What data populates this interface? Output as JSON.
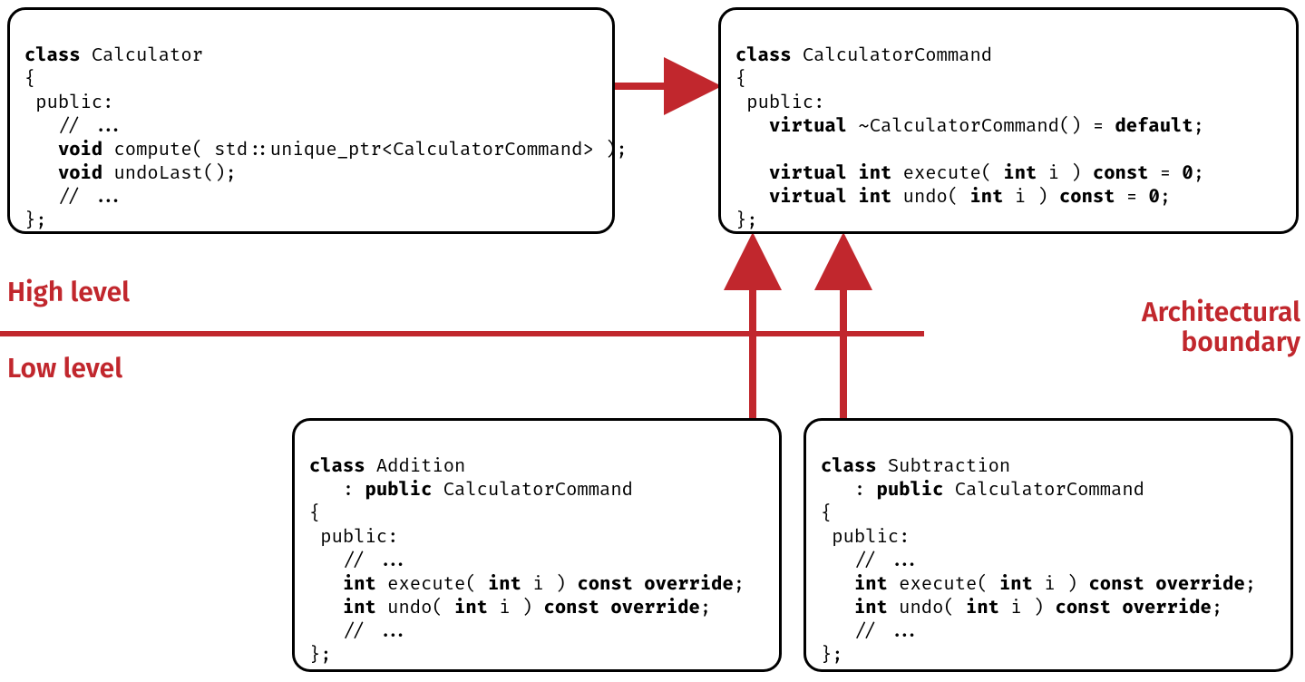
{
  "labels": {
    "high": "High level",
    "low": "Low level",
    "arch1": "Architectural",
    "arch2": "boundary"
  },
  "colors": {
    "accent": "#C1272D"
  },
  "boxes": {
    "calculator": {
      "l1a": "class",
      "l1b": " Calculator",
      "l2": "{",
      "l3": " public:",
      "l4": "   // ...",
      "l5a": "   ",
      "l5b": "void",
      "l5c": " compute( std::unique_ptr<CalculatorCommand> );",
      "l6a": "   ",
      "l6b": "void",
      "l6c": " undoLast();",
      "l7": "   // ...",
      "l8": "};"
    },
    "command": {
      "l1a": "class",
      "l1b": " CalculatorCommand",
      "l2": "{",
      "l3": " public:",
      "l4a": "   ",
      "l4b": "virtual",
      "l4c": " ~CalculatorCommand() = ",
      "l4d": "default",
      "l4e": ";",
      "l5": "",
      "l6a": "   ",
      "l6b": "virtual int",
      "l6c": " execute( ",
      "l6d": "int",
      "l6e": " i ) ",
      "l6f": "const",
      "l6g": " = ",
      "l6h": "0",
      "l6i": ";",
      "l7a": "   ",
      "l7b": "virtual int",
      "l7c": " undo( ",
      "l7d": "int",
      "l7e": " i ) ",
      "l7f": "const",
      "l7g": " = ",
      "l7h": "0",
      "l7i": ";",
      "l8": "};"
    },
    "addition": {
      "l1a": "class",
      "l1b": " Addition",
      "l2a": "   : ",
      "l2b": "public",
      "l2c": " CalculatorCommand",
      "l3": "{",
      "l4": " public:",
      "l5": "   // ...",
      "l6a": "   ",
      "l6b": "int",
      "l6c": " execute( ",
      "l6d": "int",
      "l6e": " i ) ",
      "l6f": "const override",
      "l6g": ";",
      "l7a": "   ",
      "l7b": "int",
      "l7c": " undo( ",
      "l7d": "int",
      "l7e": " i ) ",
      "l7f": "const override",
      "l7g": ";",
      "l8": "   // ...",
      "l9": "};"
    },
    "subtraction": {
      "l1a": "class",
      "l1b": " Subtraction",
      "l2a": "   : ",
      "l2b": "public",
      "l2c": " CalculatorCommand",
      "l3": "{",
      "l4": " public:",
      "l5": "   // ...",
      "l6a": "   ",
      "l6b": "int",
      "l6c": " execute( ",
      "l6d": "int",
      "l6e": " i ) ",
      "l6f": "const override",
      "l6g": ";",
      "l7a": "   ",
      "l7b": "int",
      "l7c": " undo( ",
      "l7d": "int",
      "l7e": " i ) ",
      "l7f": "const override",
      "l7g": ";",
      "l8": "   // ...",
      "l9": "};"
    }
  }
}
